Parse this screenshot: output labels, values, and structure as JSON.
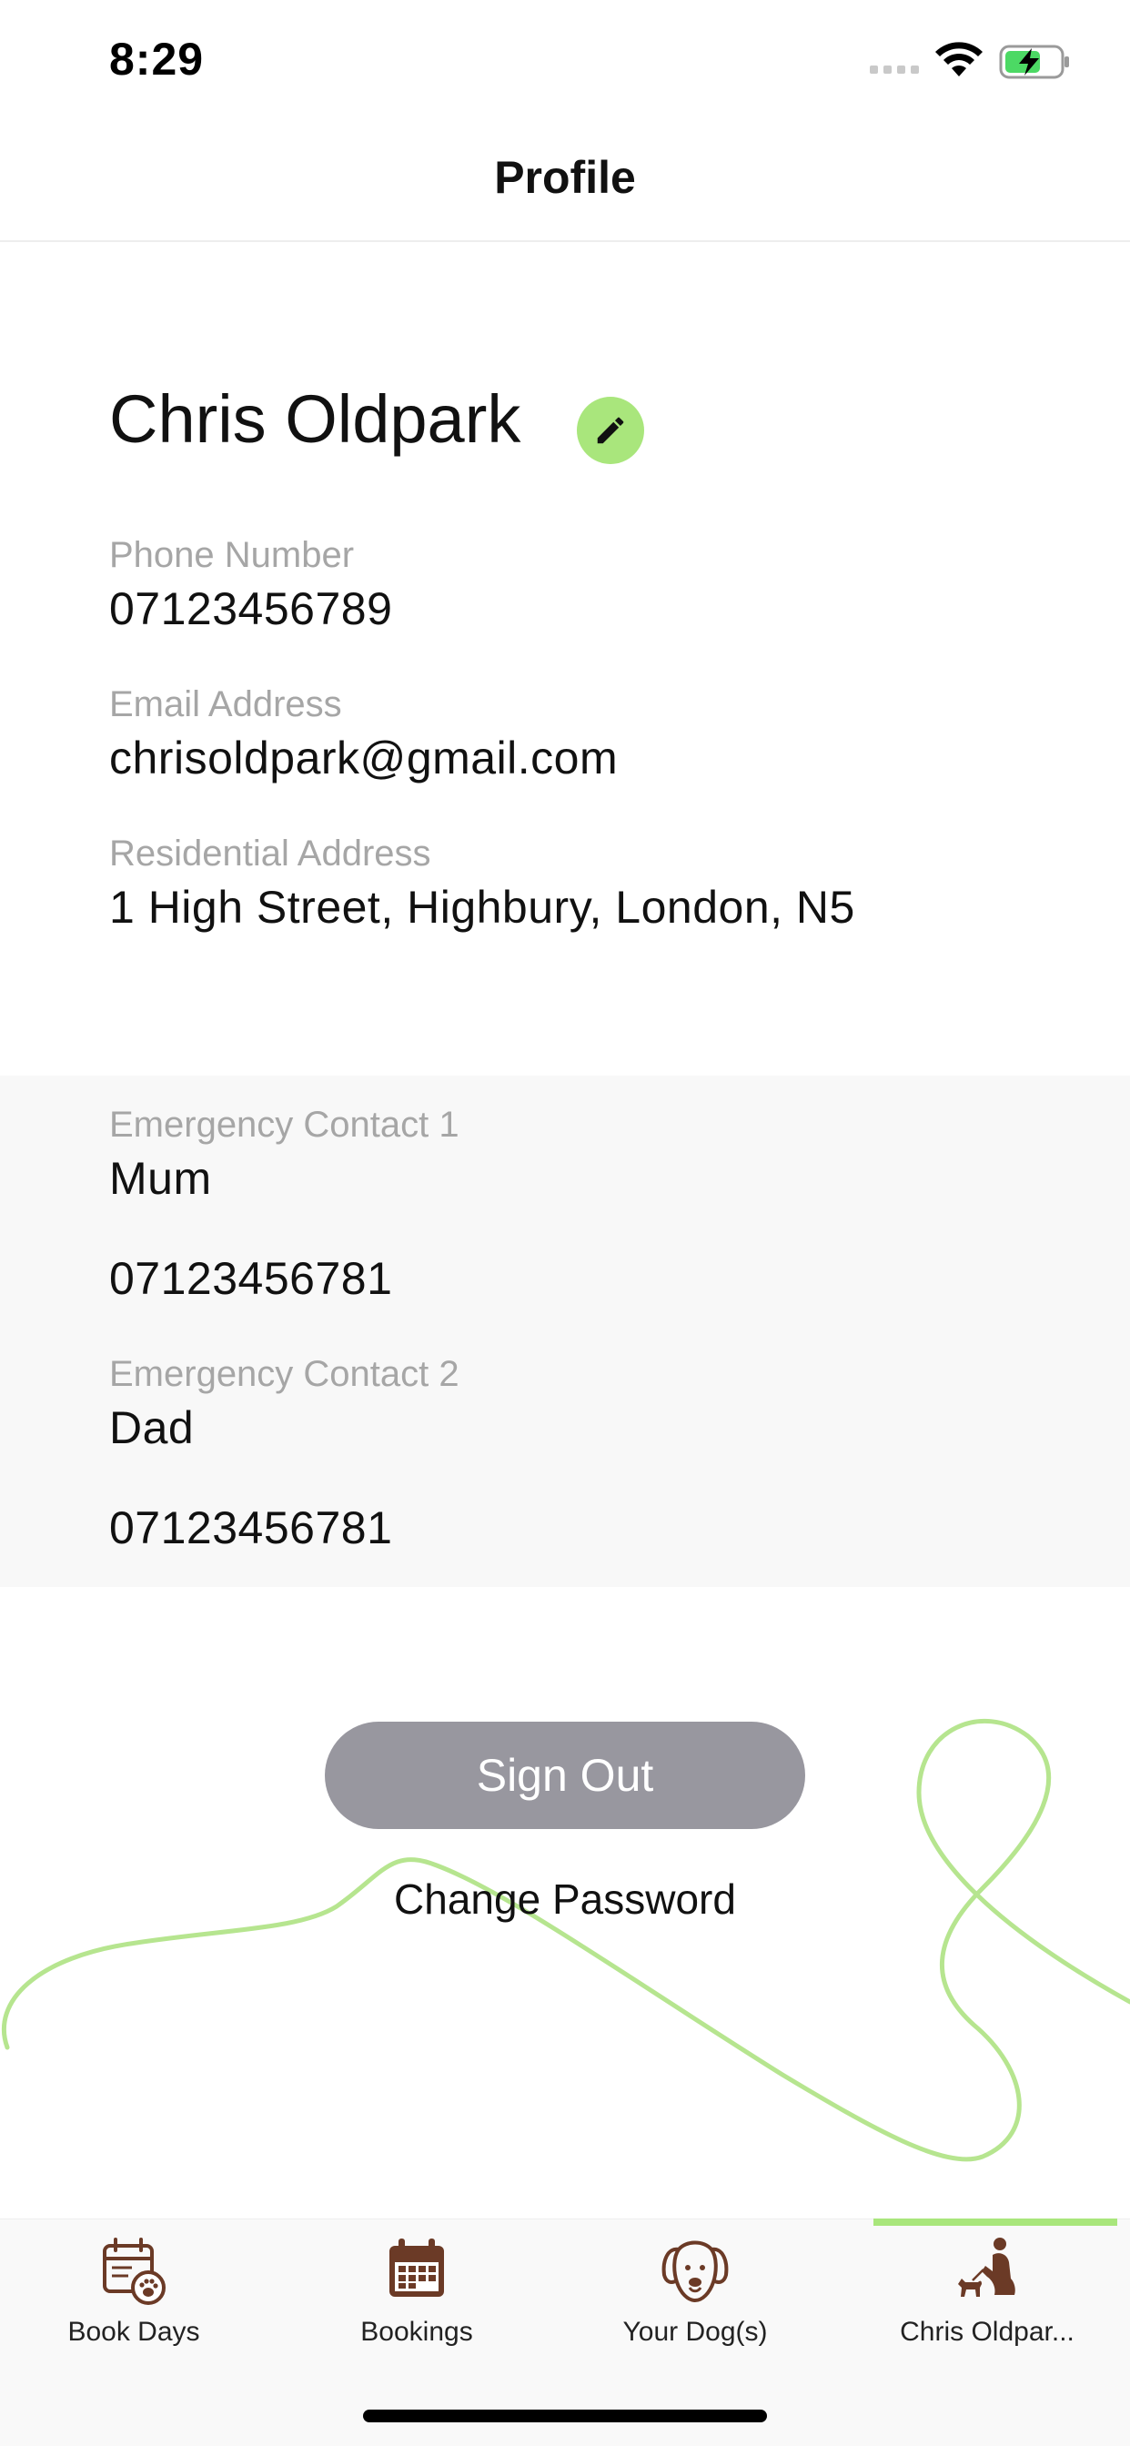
{
  "status_bar": {
    "time": "8:29"
  },
  "header": {
    "title": "Profile"
  },
  "profile": {
    "name": "Chris Oldpark",
    "fields": [
      {
        "label": "Phone Number",
        "value": "07123456789"
      },
      {
        "label": "Email Address",
        "value": "chrisoldpark@gmail.com"
      },
      {
        "label": "Residential Address",
        "value": "1 High Street, Highbury, London, N5"
      }
    ]
  },
  "emergency_contacts": [
    {
      "label": "Emergency Contact 1",
      "name": "Mum",
      "phone": "07123456781"
    },
    {
      "label": "Emergency Contact 2",
      "name": "Dad",
      "phone": "07123456781"
    }
  ],
  "actions": {
    "sign_out": "Sign Out",
    "change_password": "Change Password"
  },
  "tabs": [
    {
      "label": "Book Days",
      "icon": "calendar-paw-icon",
      "active": false
    },
    {
      "label": "Bookings",
      "icon": "calendar-grid-icon",
      "active": false
    },
    {
      "label": "Your Dog(s)",
      "icon": "dog-face-icon",
      "active": false
    },
    {
      "label": "Chris Oldpar...",
      "icon": "person-walking-dog-icon",
      "active": true
    }
  ],
  "colors": {
    "accent_green": "#a9e67c",
    "icon_brown": "#6b3a26",
    "label_gray": "#a6a6a6",
    "button_gray": "#98979f"
  }
}
